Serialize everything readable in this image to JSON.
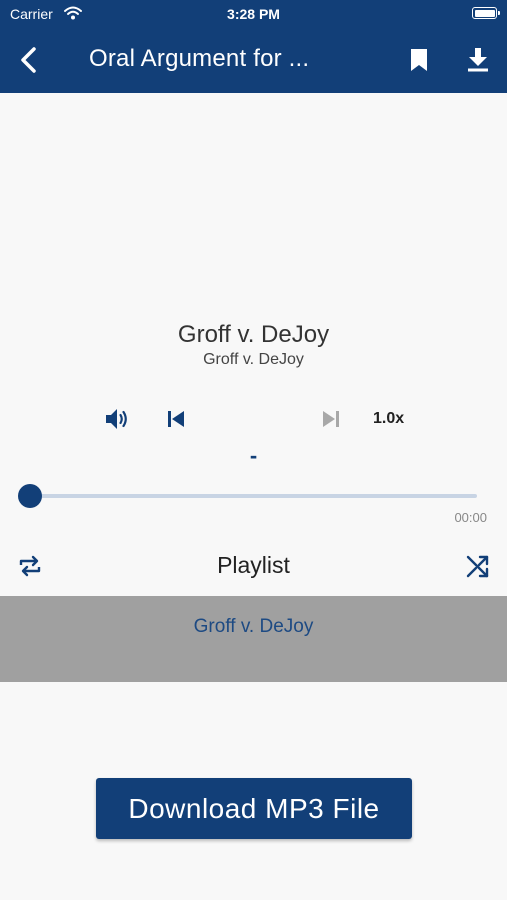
{
  "status_bar": {
    "carrier": "Carrier",
    "time": "3:28 PM"
  },
  "nav": {
    "title": "Oral Argument for ..."
  },
  "player": {
    "title": "Groff v. DeJoy",
    "subtitle": "Groff v. DeJoy",
    "speed": "1.0x",
    "position": "-",
    "elapsed": "00:00",
    "progress": 0
  },
  "playlist": {
    "label": "Playlist",
    "items": [
      {
        "title": "Groff v. DeJoy"
      }
    ]
  },
  "download_button": {
    "label": "Download MP3 File"
  },
  "colors": {
    "primary": "#123f78",
    "playlist_row_bg": "#a0a0a0",
    "slider_track": "#c8d4e4"
  }
}
